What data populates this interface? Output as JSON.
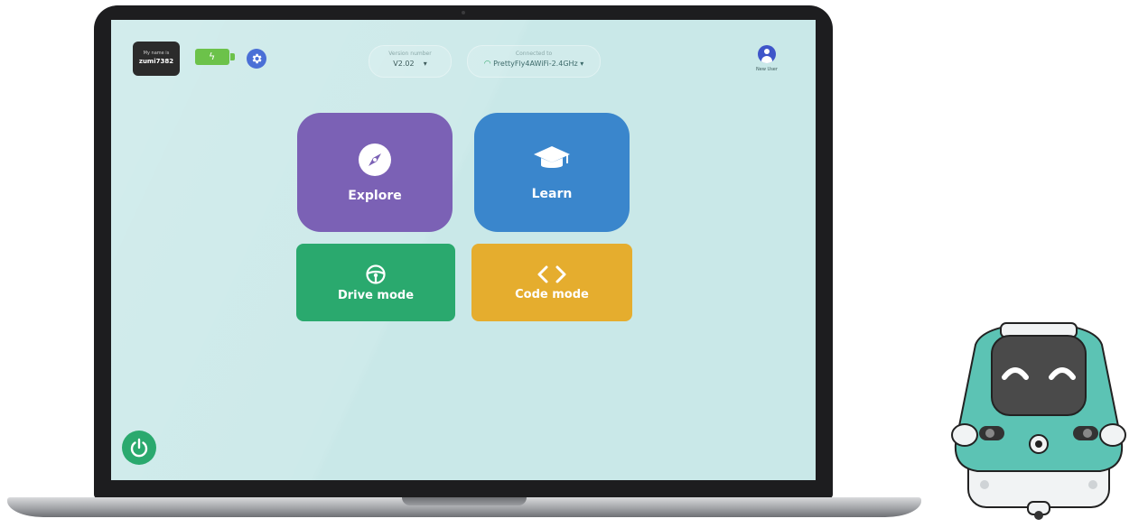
{
  "robot_badge": {
    "caption": "My name is",
    "name": "zumi7382"
  },
  "version": {
    "caption": "Version number",
    "value": "V2.02",
    "arrow": "▾"
  },
  "network": {
    "caption": "Connected to",
    "ssid": "PrettyFly4AWiFi-2.4GHz",
    "arrow": "▾"
  },
  "user": {
    "label": "New User"
  },
  "tiles": {
    "explore": "Explore",
    "learn": "Learn",
    "drive": "Drive mode",
    "code": "Code mode"
  },
  "colors": {
    "screen_bg": "#c9e8e8",
    "explore": "#7b61b5",
    "learn": "#3a86cc",
    "drive": "#2aa96e",
    "code": "#e5ad2e",
    "battery": "#6cc24a",
    "robot_body": "#5cc3b4"
  },
  "icons": {
    "explore": "compass-icon",
    "learn": "graduation-cap-icon",
    "drive": "steering-wheel-icon",
    "code": "code-brackets-icon",
    "settings": "gear-icon",
    "power": "power-icon",
    "user": "user-icon",
    "wifi": "wifi-icon",
    "battery": "battery-icon"
  }
}
